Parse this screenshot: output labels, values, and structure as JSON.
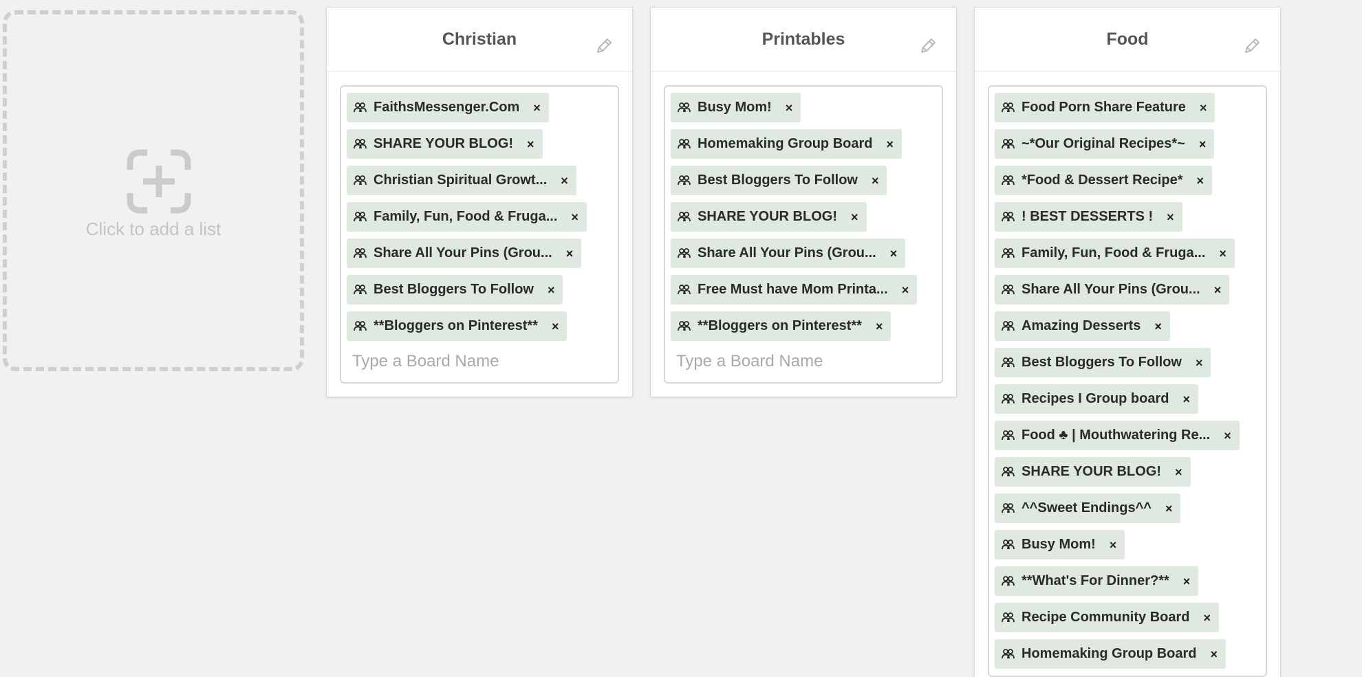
{
  "add_list": {
    "label": "Click to add a list",
    "icon": "add-list-icon"
  },
  "lists": [
    {
      "title": "Christian",
      "boards": [
        "FaithsMessenger.Com",
        "SHARE YOUR BLOG!",
        "Christian Spiritual Growt...",
        "Family, Fun, Food & Fruga...",
        "Share All Your Pins (Grou...",
        "Best Bloggers To Follow",
        "**Bloggers on Pinterest**"
      ],
      "input_placeholder": "Type a Board Name"
    },
    {
      "title": "Printables",
      "boards": [
        "Busy Mom!",
        "Homemaking Group Board",
        "Best Bloggers To Follow",
        "SHARE YOUR BLOG!",
        "Share All Your Pins (Grou...",
        "Free Must have Mom Printa...",
        "**Bloggers on Pinterest**"
      ],
      "input_placeholder": "Type a Board Name"
    },
    {
      "title": "Food",
      "boards": [
        "Food Porn Share Feature",
        "~*Our Original Recipes*~",
        "*Food & Dessert Recipe*",
        "! BEST DESSERTS !",
        "Family, Fun, Food & Fruga...",
        "Share All Your Pins (Grou...",
        "Amazing Desserts",
        "Best Bloggers To Follow",
        "Recipes I Group board",
        "Food ♣ | Mouthwatering Re...",
        "SHARE YOUR BLOG!",
        "^^Sweet Endings^^",
        "Busy Mom!",
        "**What's For Dinner?**",
        "Recipe Community Board",
        "Homemaking Group Board"
      ],
      "input_placeholder": ""
    }
  ],
  "icons": {
    "board": "group-board-icon",
    "remove": "remove-icon",
    "edit": "pencil-icon",
    "remove_glyph": "×"
  },
  "colors": {
    "background": "#f1f1f0",
    "chip": "#dfe9df",
    "title": "#555555",
    "dashed_border": "#cfcfcf"
  }
}
